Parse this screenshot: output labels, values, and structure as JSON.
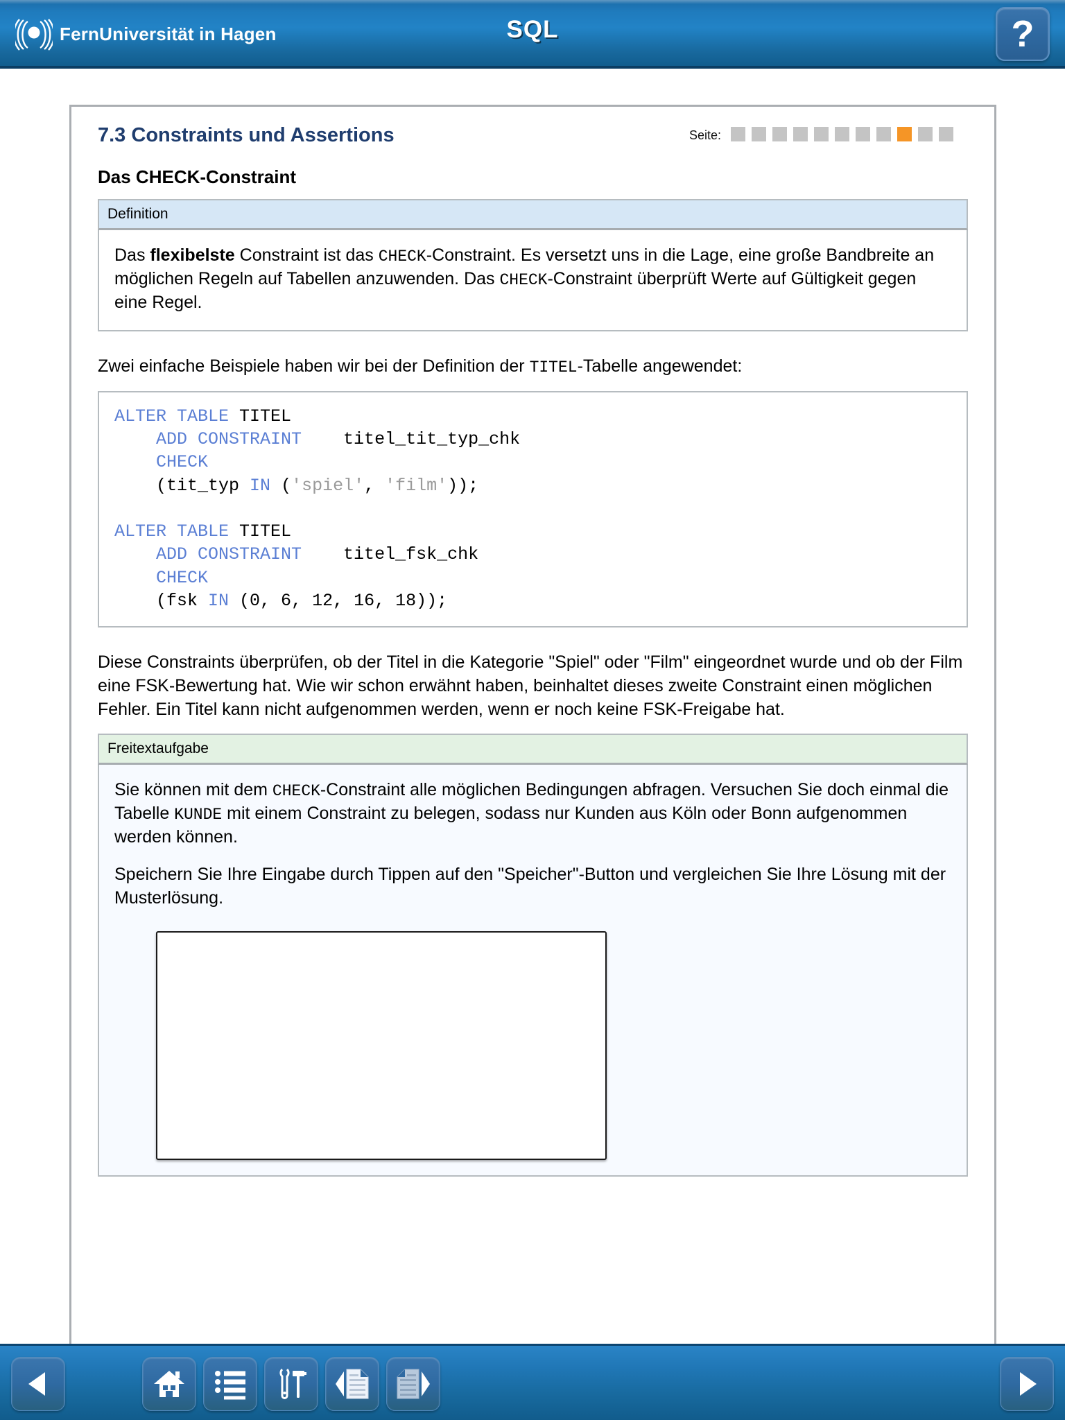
{
  "header": {
    "brand_name": "FernUniversität in Hagen",
    "brand_logo_icon": "fernuni-rings-logo-icon",
    "app_title": "SQL",
    "help_label": "?",
    "help_icon": "question-mark-icon"
  },
  "page": {
    "section_number_title": "7.3 Constraints und Assertions",
    "pager_label": "Seite:",
    "pager_total": 11,
    "pager_active_index": 9,
    "sub_title": "Das CHECK-Constraint"
  },
  "definition_box": {
    "header": "Definition",
    "text_parts": {
      "p1_a": "Das ",
      "p1_bold": "flexibelste",
      "p1_b": " Constraint ist das ",
      "p1_code1": "CHECK",
      "p1_c": "-Constraint. Es versetzt uns in die Lage, eine große Bandbreite an möglichen Regeln auf Tabellen anzuwenden. Das ",
      "p1_code2": "CHECK",
      "p1_d": "-Constraint überprüft Werte auf Gültigkeit gegen eine Regel."
    }
  },
  "intro_paragraph": {
    "a": "Zwei einfache Beispiele haben wir bei der Definition der ",
    "code": "TITEL",
    "b": "-Tabelle angewendet:"
  },
  "code_block": {
    "lines": [
      {
        "tokens": [
          {
            "t": "ALTER TABLE ",
            "c": "kw"
          },
          {
            "t": "TITEL",
            "c": "plain"
          }
        ]
      },
      {
        "tokens": [
          {
            "t": "    ADD CONSTRAINT",
            "c": "kw"
          },
          {
            "t": "    titel_tit_typ_chk",
            "c": "plain"
          }
        ]
      },
      {
        "tokens": [
          {
            "t": "    CHECK",
            "c": "kw"
          }
        ]
      },
      {
        "tokens": [
          {
            "t": "    (tit_typ ",
            "c": "plain"
          },
          {
            "t": "IN",
            "c": "kw"
          },
          {
            "t": " (",
            "c": "plain"
          },
          {
            "t": "'spiel'",
            "c": "str"
          },
          {
            "t": ", ",
            "c": "plain"
          },
          {
            "t": "'film'",
            "c": "str"
          },
          {
            "t": "));",
            "c": "plain"
          }
        ]
      },
      {
        "tokens": [
          {
            "t": "",
            "c": "plain"
          }
        ]
      },
      {
        "tokens": [
          {
            "t": "ALTER TABLE ",
            "c": "kw"
          },
          {
            "t": "TITEL",
            "c": "plain"
          }
        ]
      },
      {
        "tokens": [
          {
            "t": "    ADD CONSTRAINT",
            "c": "kw"
          },
          {
            "t": "    titel_fsk_chk",
            "c": "plain"
          }
        ]
      },
      {
        "tokens": [
          {
            "t": "    CHECK",
            "c": "kw"
          }
        ]
      },
      {
        "tokens": [
          {
            "t": "    (fsk ",
            "c": "plain"
          },
          {
            "t": "IN",
            "c": "kw"
          },
          {
            "t": " (0, 6, 12, 16, 18));",
            "c": "plain"
          }
        ]
      }
    ]
  },
  "explanation_paragraph": "Diese Constraints überprüfen, ob der Titel in die Kategorie \"Spiel\" oder \"Film\" eingeordnet wurde und ob der Film eine FSK-Bewertung hat. Wie wir schon erwähnt haben, beinhaltet dieses zweite Constraint einen möglichen Fehler. Ein Titel kann nicht aufgenommen werden, wenn er noch keine FSK-Freigabe hat.",
  "exercise_box": {
    "header": "Freitextaufgabe",
    "p1_a": "Sie können mit dem ",
    "p1_code1": "CHECK",
    "p1_b": "-Constraint alle möglichen Bedingungen abfragen. Versuchen Sie doch einmal die Tabelle ",
    "p1_code2": "KUNDE",
    "p1_c": " mit einem Constraint zu belegen, sodass nur Kunden aus Köln oder Bonn aufgenommen werden können.",
    "p2": "Speichern Sie Ihre Eingabe durch Tippen auf den \"Speicher\"-Button und vergleichen Sie Ihre Lösung mit der Musterlösung.",
    "answer_value": "",
    "answer_placeholder": ""
  },
  "toolbar": {
    "back_icon": "triangle-left-icon",
    "home_icon": "home-icon",
    "list_icon": "list-bullets-icon",
    "tools_icon": "wrench-hammer-icon",
    "prev_doc_icon": "document-previous-icon",
    "next_doc_icon": "document-next-icon",
    "forward_icon": "triangle-right-icon"
  },
  "colors": {
    "brand_blue": "#1f7bbd",
    "header_dark": "#0b3d63",
    "title_navy": "#1f3d6e",
    "pager_active": "#f59526",
    "pager_inactive": "#c4c4c4",
    "definition_head": "#d6e7f6",
    "exercise_head": "#e3f2e3",
    "code_keyword": "#5b7fd4",
    "code_string": "#9a9a9a"
  }
}
